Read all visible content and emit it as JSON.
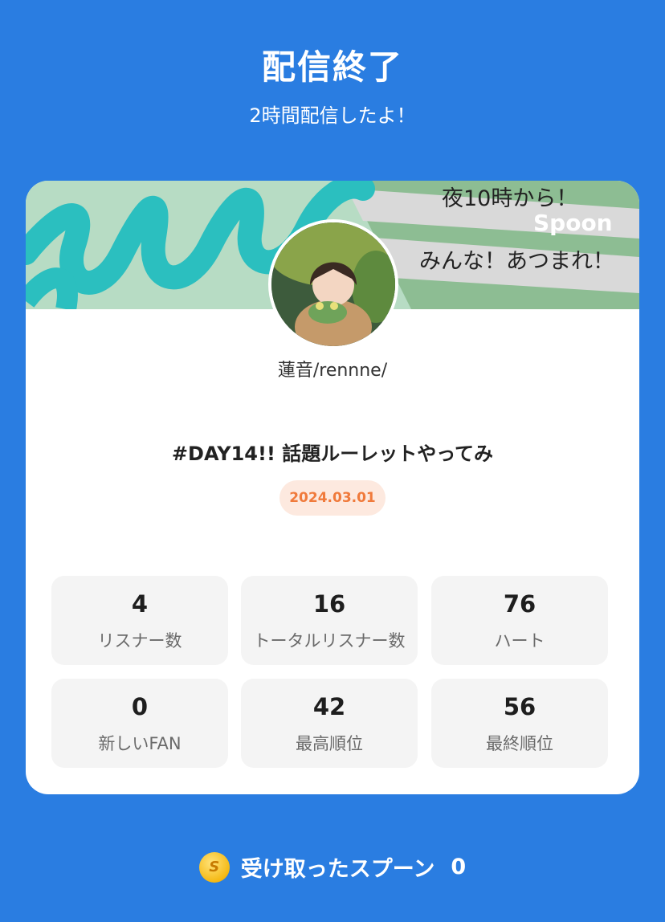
{
  "header": {
    "title": "配信終了",
    "subtitle": "2時間配信したよ！"
  },
  "card": {
    "banner": {
      "line1": "夜10時から！",
      "brand": "Spoon",
      "line2": "みんな！あつまれ！"
    },
    "username": "蓮音/rennne/",
    "cast_title": "#DAY14!! 話題ルーレットやってみ",
    "date": "2024.03.01",
    "stats": [
      {
        "value": "4",
        "label": "リスナー数"
      },
      {
        "value": "16",
        "label": "トータルリスナー数"
      },
      {
        "value": "76",
        "label": "ハート"
      },
      {
        "value": "0",
        "label": "新しいFAN"
      },
      {
        "value": "42",
        "label": "最高順位"
      },
      {
        "value": "56",
        "label": "最終順位"
      }
    ]
  },
  "footer": {
    "coin_letter": "S",
    "label": "受け取ったスプーン",
    "count": "0"
  },
  "colors": {
    "background": "#2a7de1",
    "accent_orange": "#f07a3b",
    "badge_bg": "#fde9df"
  }
}
